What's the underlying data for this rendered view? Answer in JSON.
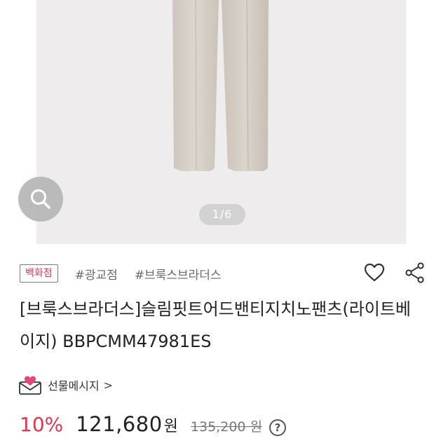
{
  "gallery": {
    "indicator": "1/6",
    "zoom_icon": "magnifier-icon"
  },
  "product": {
    "store_badge": "백화점",
    "tags": [
      "#광교점",
      "#브룩스브라더스"
    ],
    "title": "[브룩스브라더스]슬림핏트어드밴티지치노팬츠(라이트베이지) BBPCMM47981ES",
    "wishlist_icon": "heart-outline-icon",
    "share_icon": "share-icon"
  },
  "gift": {
    "label": "선물메시지",
    "chevron": ">",
    "icon": "gift-envelope-heart-icon"
  },
  "price": {
    "discount": "10%",
    "sale": "121,680",
    "sale_unit": "원",
    "original": "135,200 원",
    "help": "?"
  },
  "colors": {
    "accent": "#e6334e",
    "product": "#d6cfc7",
    "gift_heart": "#e8457a"
  }
}
